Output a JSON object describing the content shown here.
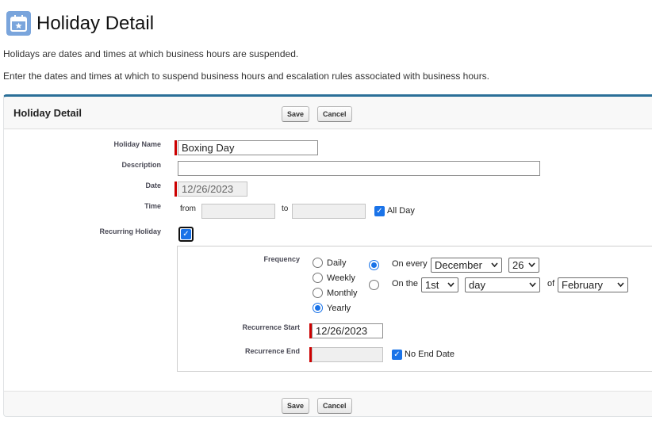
{
  "header": {
    "icon": "calendar-star-icon",
    "title": "Holiday Detail",
    "description_1": "Holidays are dates and times at which business hours are suspended.",
    "description_2": "Enter the dates and times at which to suspend business hours and escalation rules associated with business hours."
  },
  "panel": {
    "title": "Holiday Detail",
    "save_label": "Save",
    "cancel_label": "Cancel"
  },
  "form": {
    "holiday_name_label": "Holiday Name",
    "holiday_name_value": "Boxing Day",
    "description_label": "Description",
    "description_value": "",
    "date_label": "Date",
    "date_value": "12/26/2023",
    "time_label": "Time",
    "from_label": "from",
    "to_label": "to",
    "from_value": "",
    "to_value": "",
    "all_day_label": "All Day",
    "all_day_checked": true,
    "recurring_label": "Recurring Holiday",
    "recurring_checked": true
  },
  "recurrence": {
    "frequency_label": "Frequency",
    "options": [
      "Daily",
      "Weekly",
      "Monthly",
      "Yearly"
    ],
    "selected_frequency": "Yearly",
    "on_every_label": "On every",
    "on_every_month": "December",
    "on_every_day": "26",
    "on_the_label": "On the",
    "on_the_ordinal": "1st",
    "on_the_weekday": "day",
    "of_label": "of",
    "on_the_month": "February",
    "selected_pattern": "On every",
    "start_label": "Recurrence Start",
    "start_value": "12/26/2023",
    "end_label": "Recurrence End",
    "end_value": "",
    "no_end_label": "No End Date",
    "no_end_checked": true
  },
  "colors": {
    "accent": "#1a73e8",
    "panel_border": "#2b6f98",
    "required": "#cc0000",
    "icon_bg": "#7aa5dc"
  }
}
